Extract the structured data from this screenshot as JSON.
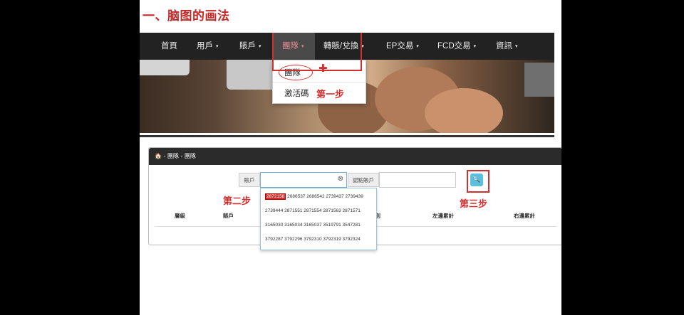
{
  "heading": "一、脑图的画法",
  "nav": {
    "items": [
      {
        "label": "首頁",
        "caret": false
      },
      {
        "label": "用戶",
        "caret": true
      },
      {
        "label": "賬戶",
        "caret": true
      },
      {
        "label": "團隊",
        "caret": true,
        "active": true
      },
      {
        "label": "轉賬/兌換",
        "caret": true
      },
      {
        "label": "EP交易",
        "caret": true
      },
      {
        "label": "FCD交易",
        "caret": true
      },
      {
        "label": "資訊",
        "caret": true
      }
    ],
    "caret_glyph": "▾"
  },
  "dropdown": {
    "items": [
      "團隊",
      "激活碼"
    ],
    "plus": "✚"
  },
  "annotations": {
    "step1": "第一步",
    "step2": "第二步",
    "step3": "第三步"
  },
  "panel": {
    "breadcrumb": "🏠 - 團隊 - 團隊",
    "account_label": "賬戶",
    "referrer_label": "認點賬戶",
    "search_icon": "search-icon",
    "columns": [
      "層級",
      "賬戶",
      "級別",
      "左邊累計",
      "右邊累計"
    ]
  },
  "suggestions": {
    "highlight": "2872158",
    "rows": [
      [
        "2686537",
        "2686542",
        "2739437",
        "2739439"
      ],
      [
        "2739444",
        "2871551",
        "2871554",
        "2871563",
        "2871571"
      ],
      [
        "3165030",
        "3165034",
        "3165037",
        "3519791",
        "3547281"
      ],
      [
        "3792287",
        "3792296",
        "3792310",
        "3792319",
        "3792324"
      ]
    ]
  },
  "colors": {
    "accent_red": "#d32f2f",
    "navbar_bg": "#222222",
    "button_blue": "#5bc0de"
  }
}
